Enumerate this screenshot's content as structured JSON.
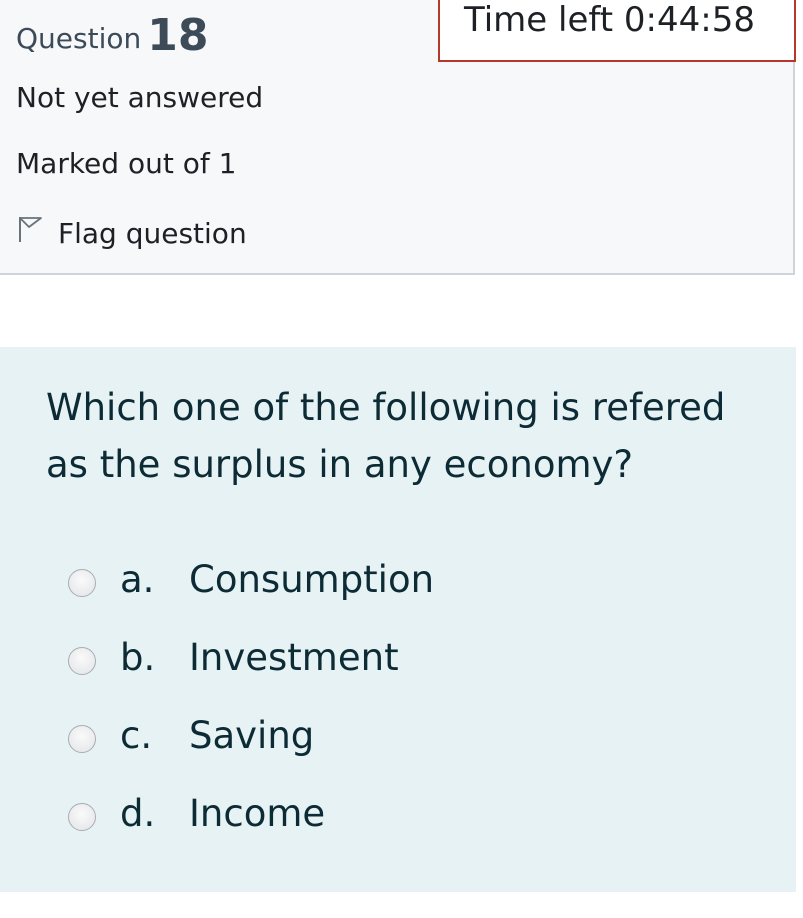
{
  "question_info": {
    "label": "Question",
    "number": "18",
    "state": "Not yet answered",
    "grade": "Marked out of 1",
    "flag_label": "Flag question"
  },
  "timer": {
    "text": "Time left 0:44:58"
  },
  "question": {
    "text": "Which one of the following is refered as the surplus in any economy?",
    "options": [
      {
        "letter": "a.",
        "label": "Consumption"
      },
      {
        "letter": "b.",
        "label": "Investment"
      },
      {
        "letter": "c.",
        "label": "Saving"
      },
      {
        "letter": "d.",
        "label": "Income"
      }
    ]
  },
  "colors": {
    "info_background": "#f7f8fa",
    "formulation_background": "#e6f2f4",
    "timer_border": "#b5382c",
    "text_dark": "#0d2b35"
  }
}
